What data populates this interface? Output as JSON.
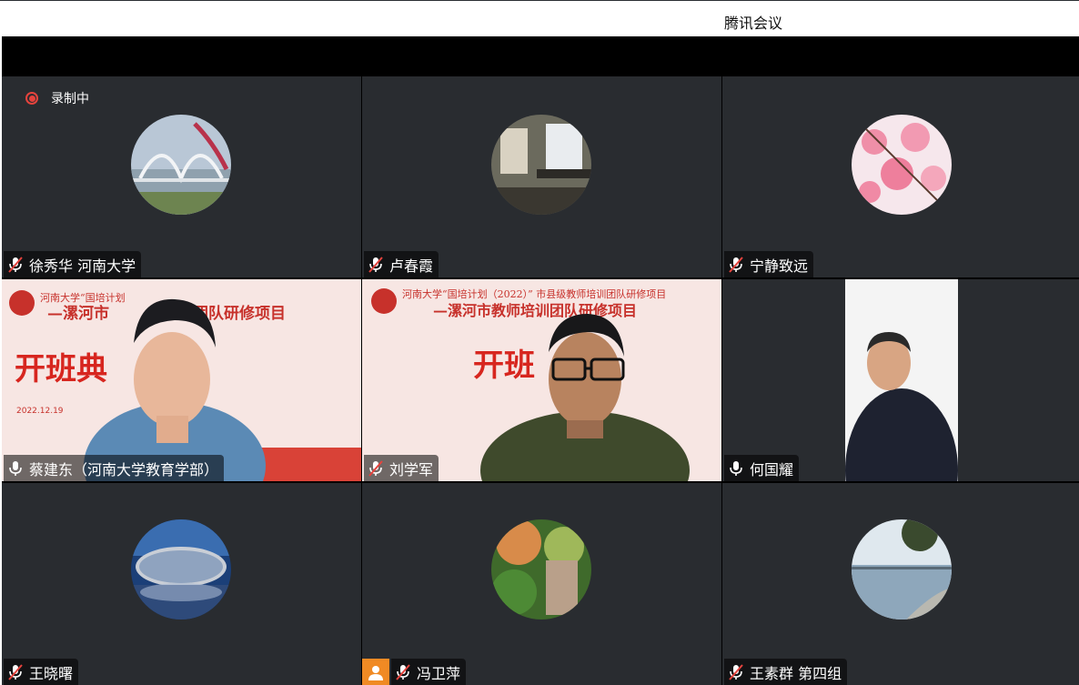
{
  "window": {
    "title": "腾讯会议"
  },
  "recording": {
    "label": "录制中"
  },
  "participants": [
    {
      "name": "徐秀华 河南大学",
      "mic": "muted",
      "avatar": "bridge-photo"
    },
    {
      "name": "卢春霞",
      "mic": "muted",
      "avatar": "room-photo"
    },
    {
      "name": "宁静致远",
      "mic": "muted",
      "avatar": "blossom-photo"
    },
    {
      "name": "蔡建东（河南大学教育学部）",
      "mic": "on",
      "video": "camera-on",
      "speaking": true
    },
    {
      "name": "刘学军",
      "mic": "muted",
      "video": "camera-on"
    },
    {
      "name": "何国耀",
      "mic": "on",
      "video": "camera-on"
    },
    {
      "name": "王晓曙",
      "mic": "muted",
      "avatar": "theater-photo"
    },
    {
      "name": "冯卫萍",
      "mic": "muted",
      "avatar": "forest-photo",
      "user_badge": "user-icon"
    },
    {
      "name": "王素群 第四组",
      "mic": "muted",
      "avatar": "lake-photo"
    }
  ],
  "banner": {
    "line1": "河南大学“国培计划（2022）” 市县级教师培训团队研修项目",
    "line2": "—漯河市教师培训团队研修项目",
    "headline": "开班典礼",
    "date": "2022.12.19"
  },
  "colors": {
    "tile": "#292c30",
    "speaking": "#2fa24a",
    "recording": "#e5433d",
    "badge": "#f08a24"
  }
}
